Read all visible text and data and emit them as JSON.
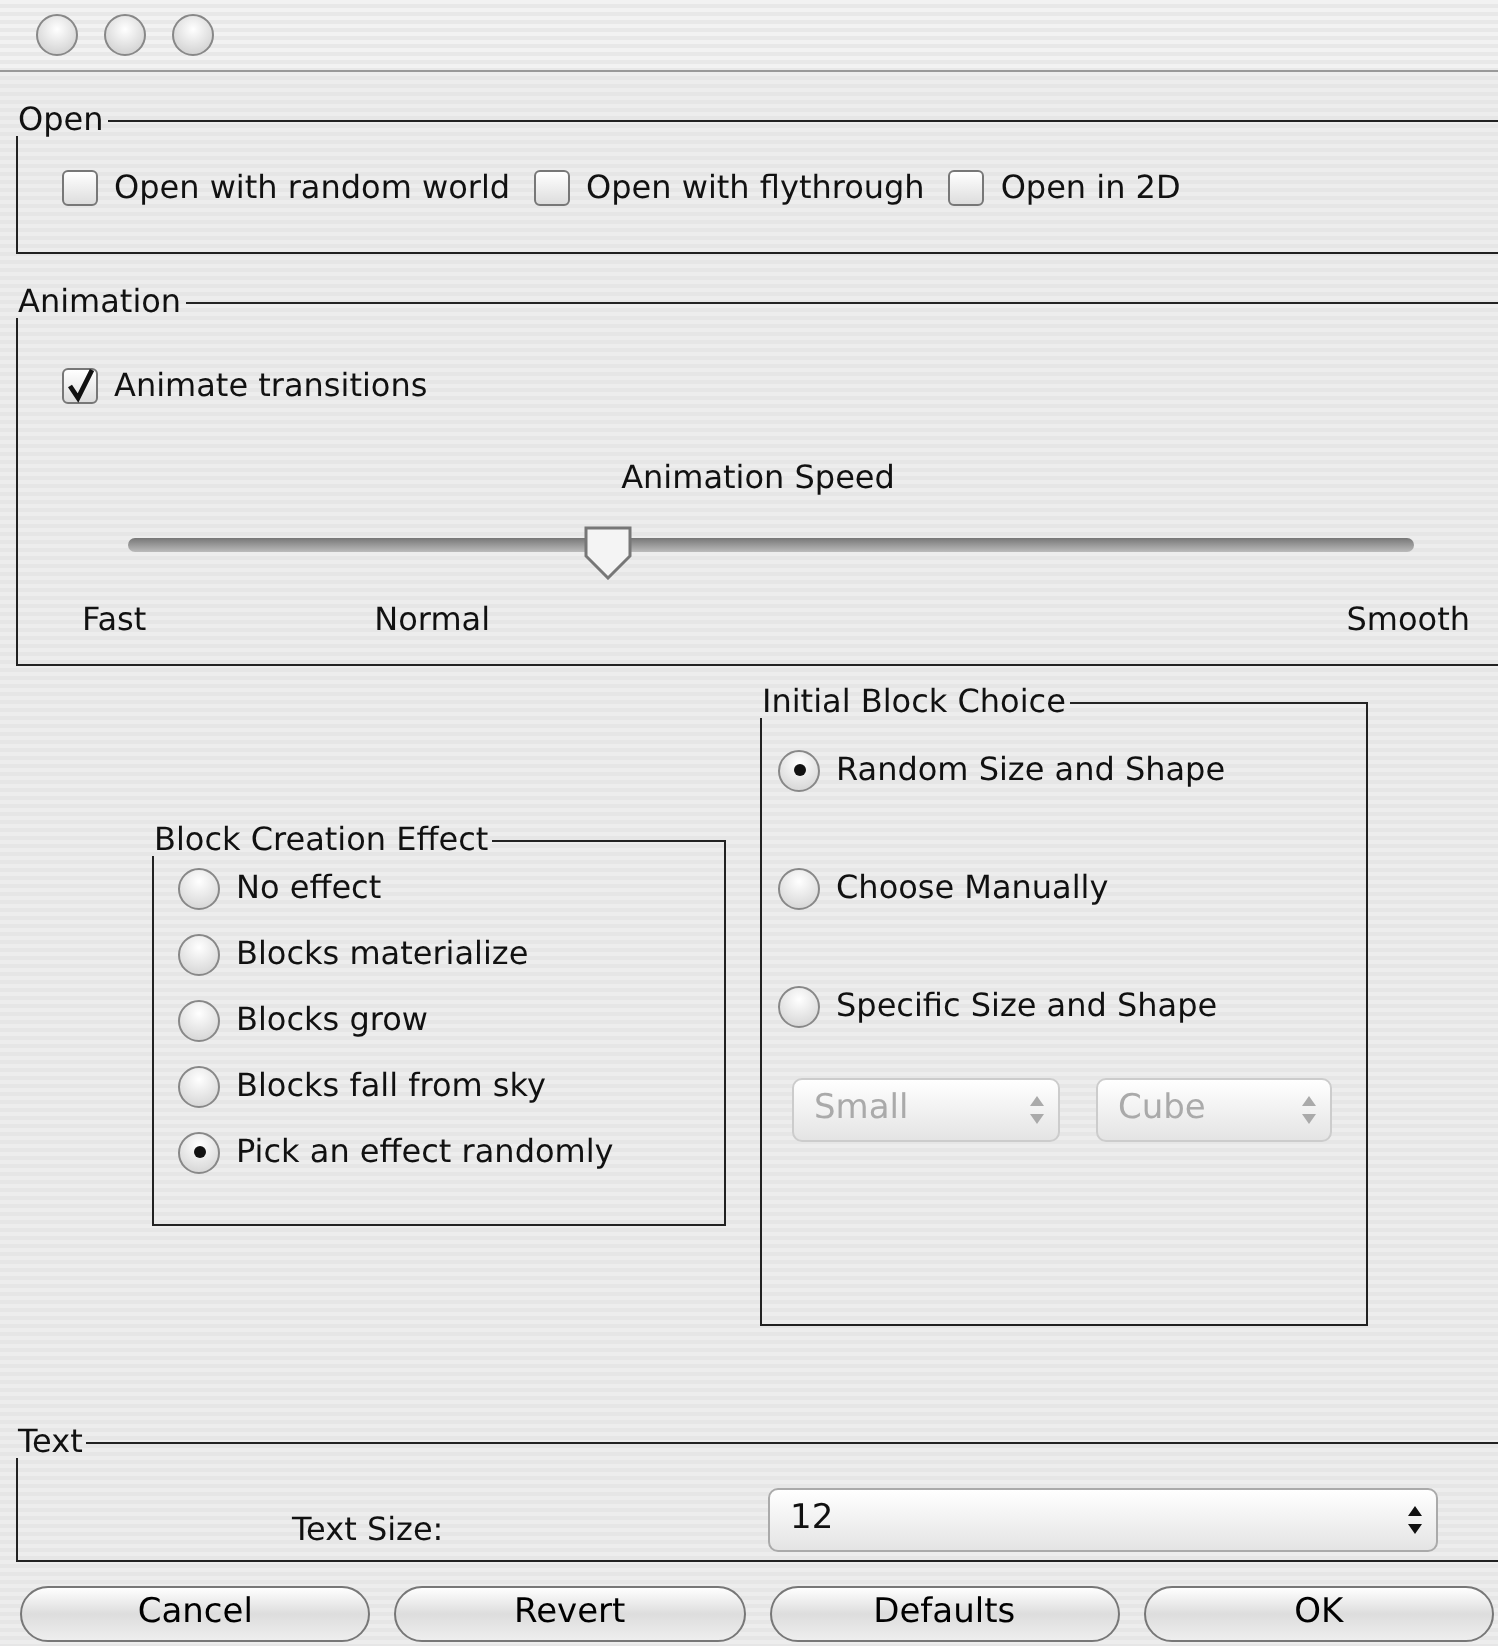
{
  "open": {
    "legend": "Open",
    "checkboxes": [
      {
        "label": "Open with random world",
        "checked": false
      },
      {
        "label": "Open with flythrough",
        "checked": false
      },
      {
        "label": "Open in 2D",
        "checked": false
      }
    ]
  },
  "animation": {
    "legend": "Animation",
    "checkbox": {
      "label": "Animate transitions",
      "checked": true
    },
    "slider": {
      "title": "Animation Speed",
      "level": 0.374,
      "labels": [
        "Fast",
        "Normal",
        "Smooth"
      ]
    }
  },
  "block_creation_effect": {
    "legend": "Block Creation Effect",
    "options": [
      {
        "label": "No effect",
        "selected": false
      },
      {
        "label": "Blocks materialize",
        "selected": false
      },
      {
        "label": "Blocks grow",
        "selected": false
      },
      {
        "label": "Blocks fall from sky",
        "selected": false
      },
      {
        "label": "Pick an effect randomly",
        "selected": true
      }
    ]
  },
  "initial_block_choice": {
    "legend": "Initial Block Choice",
    "options": [
      {
        "label": "Random Size and Shape",
        "selected": true
      },
      {
        "label": "Choose Manually",
        "selected": false
      },
      {
        "label": "Specific Size and Shape",
        "selected": false
      }
    ],
    "selects": [
      {
        "value": "Small",
        "disabled": true
      },
      {
        "value": "Cube",
        "disabled": true
      }
    ]
  },
  "text": {
    "legend": "Text",
    "label": "Text Size:",
    "select": {
      "value": "12"
    }
  },
  "buttons": [
    {
      "label": "Cancel"
    },
    {
      "label": "Revert"
    },
    {
      "label": "Defaults"
    },
    {
      "label": "OK"
    }
  ]
}
